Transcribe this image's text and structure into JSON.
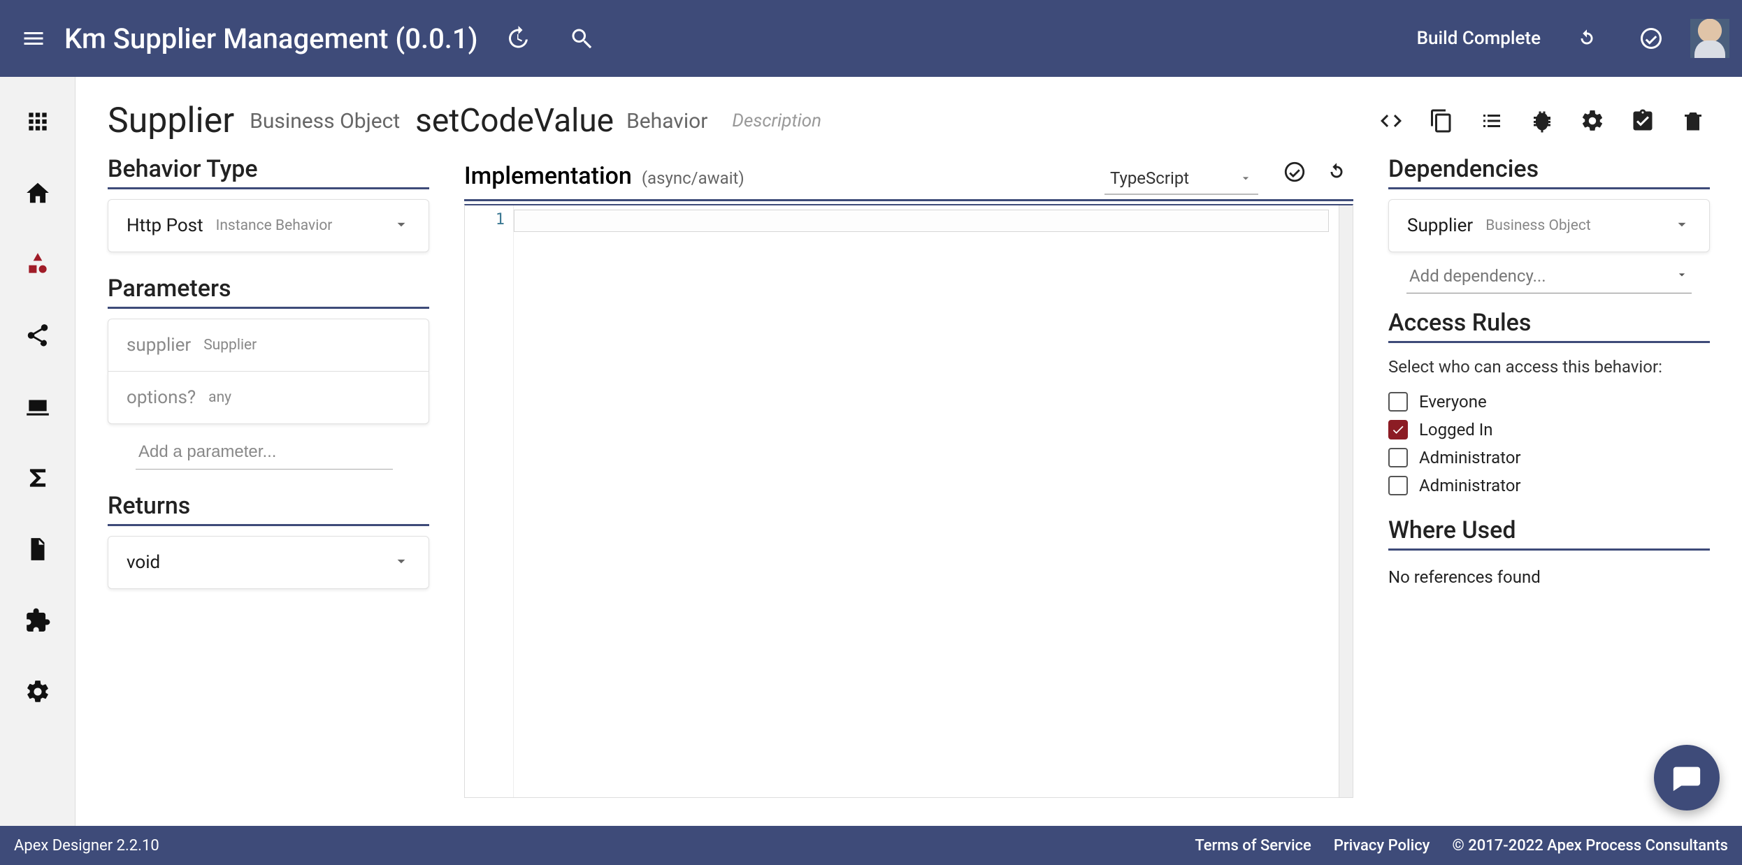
{
  "appbar": {
    "title": "Km Supplier Management (0.0.1)",
    "status": "Build Complete"
  },
  "header": {
    "bo_name": "Supplier",
    "bo_type": "Business Object",
    "behavior_name": "setCodeValue",
    "behavior_label": "Behavior",
    "description_placeholder": "Description"
  },
  "left": {
    "behavior_type_title": "Behavior Type",
    "behavior_type": {
      "value": "Http Post",
      "note": "Instance Behavior"
    },
    "parameters_title": "Parameters",
    "parameters": [
      {
        "name": "supplier",
        "type": "Supplier"
      },
      {
        "name": "options?",
        "type": "any"
      }
    ],
    "add_parameter_placeholder": "Add a parameter...",
    "returns_title": "Returns",
    "returns_value": "void"
  },
  "impl": {
    "title": "Implementation",
    "mode": "(async/await)",
    "language": "TypeScript",
    "line1": "1"
  },
  "right": {
    "dependencies_title": "Dependencies",
    "dep_item": {
      "name": "Supplier",
      "type": "Business Object"
    },
    "add_dependency_placeholder": "Add dependency...",
    "access_title": "Access Rules",
    "access_help": "Select who can access this behavior:",
    "rules": [
      {
        "label": "Everyone",
        "checked": false
      },
      {
        "label": "Logged In",
        "checked": true
      },
      {
        "label": "Administrator",
        "checked": false
      },
      {
        "label": "Administrator",
        "checked": false
      }
    ],
    "where_used_title": "Where Used",
    "where_used_text": "No references found"
  },
  "footer": {
    "version": "Apex Designer 2.2.10",
    "tos": "Terms of Service",
    "privacy": "Privacy Policy",
    "copyright": "© 2017-2022 Apex Process Consultants"
  }
}
